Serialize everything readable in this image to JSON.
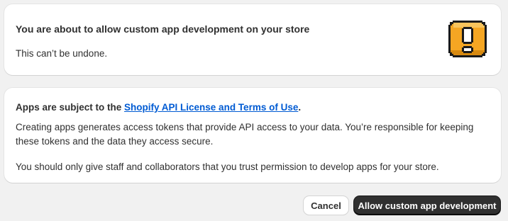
{
  "warning": {
    "title": "You are about to allow custom app development on your store",
    "body": "This can’t be undone.",
    "icon": "warning-exclamation-icon",
    "icon_color": "#f5a623"
  },
  "terms": {
    "heading_prefix": "Apps are subject to the ",
    "link_text": "Shopify API License and Terms of Use",
    "heading_suffix": ".",
    "paragraph1": "Creating apps generates access tokens that provide API access to your data. You’re responsible for keeping these tokens and the data they access secure.",
    "paragraph2": "You should only give staff and collaborators that you trust permission to develop apps for your store."
  },
  "actions": {
    "cancel_label": "Cancel",
    "confirm_label": "Allow custom app development"
  },
  "colors": {
    "link": "#005bd3",
    "primary_button": "#303030",
    "background": "#f1f1f1"
  }
}
